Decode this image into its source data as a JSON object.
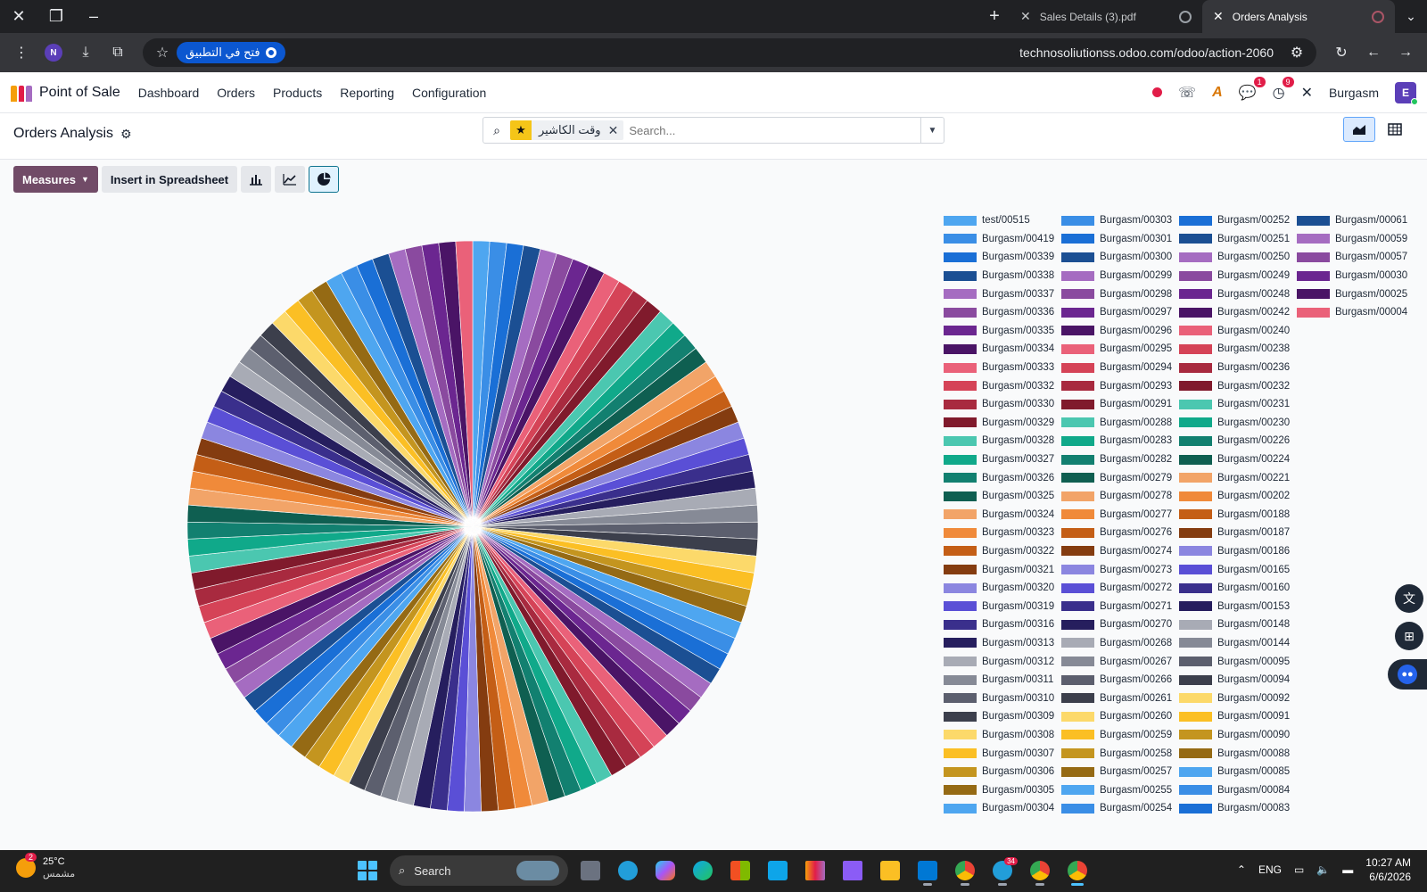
{
  "browser": {
    "tabs": [
      {
        "title": "Sales Details (3).pdf",
        "active": false
      },
      {
        "title": "Orders Analysis",
        "active": true
      }
    ],
    "profile_initial": "N",
    "open_in_app": "فتح في التطبيق",
    "url": "technosoliutionss.odoo.com/odoo/action-2060"
  },
  "navbar": {
    "app_name": "Point of Sale",
    "menu": [
      "Dashboard",
      "Orders",
      "Products",
      "Reporting",
      "Configuration"
    ],
    "messages_count": "1",
    "activities_count": "9",
    "company": "Burgasm",
    "user_initial": "E"
  },
  "control_panel": {
    "title": "Orders Analysis",
    "facet": "وقت الكاشير",
    "search_placeholder": "Search..."
  },
  "toolbar": {
    "measures": "Measures",
    "insert_spreadsheet": "Insert in Spreadsheet"
  },
  "chart_data": {
    "type": "pie",
    "legend_placement": "right",
    "series": [
      {
        "name": "test/00515",
        "value": 1,
        "color": "#4ea6f0"
      },
      {
        "name": "Burgasm/00419",
        "value": 1,
        "color": "#3a8ee6"
      },
      {
        "name": "Burgasm/00339",
        "value": 1,
        "color": "#1a6fd6"
      },
      {
        "name": "Burgasm/00338",
        "value": 1,
        "color": "#1b4f93"
      },
      {
        "name": "Burgasm/00337",
        "value": 1,
        "color": "#a56cc1"
      },
      {
        "name": "Burgasm/00336",
        "value": 1,
        "color": "#8a4a9f"
      },
      {
        "name": "Burgasm/00335",
        "value": 1,
        "color": "#6b2690"
      },
      {
        "name": "Burgasm/00334",
        "value": 1,
        "color": "#4a1466"
      },
      {
        "name": "Burgasm/00333",
        "value": 1,
        "color": "#ea6179"
      },
      {
        "name": "Burgasm/00332",
        "value": 1,
        "color": "#d54357"
      },
      {
        "name": "Burgasm/00330",
        "value": 1,
        "color": "#a82a3f"
      },
      {
        "name": "Burgasm/00329",
        "value": 1,
        "color": "#801a2c"
      },
      {
        "name": "Burgasm/00328",
        "value": 1,
        "color": "#4bc7b0"
      },
      {
        "name": "Burgasm/00327",
        "value": 1,
        "color": "#10a98a"
      },
      {
        "name": "Burgasm/00326",
        "value": 1,
        "color": "#128070"
      },
      {
        "name": "Burgasm/00325",
        "value": 1,
        "color": "#0f5f51"
      },
      {
        "name": "Burgasm/00324",
        "value": 1,
        "color": "#f2a468"
      },
      {
        "name": "Burgasm/00323",
        "value": 1,
        "color": "#f08a3a"
      },
      {
        "name": "Burgasm/00322",
        "value": 1,
        "color": "#c45e16"
      },
      {
        "name": "Burgasm/00321",
        "value": 1,
        "color": "#843c10"
      },
      {
        "name": "Burgasm/00320",
        "value": 1,
        "color": "#8b86e0"
      },
      {
        "name": "Burgasm/00319",
        "value": 1,
        "color": "#5a4fd6"
      },
      {
        "name": "Burgasm/00316",
        "value": 1,
        "color": "#3a2f8c"
      },
      {
        "name": "Burgasm/00313",
        "value": 1,
        "color": "#261e5e"
      },
      {
        "name": "Burgasm/00312",
        "value": 1,
        "color": "#a8abb5"
      },
      {
        "name": "Burgasm/00311",
        "value": 1,
        "color": "#868a96"
      },
      {
        "name": "Burgasm/00310",
        "value": 1,
        "color": "#5c5f6e"
      },
      {
        "name": "Burgasm/00309",
        "value": 1,
        "color": "#3c3f4c"
      },
      {
        "name": "Burgasm/00308",
        "value": 1,
        "color": "#fcd96a"
      },
      {
        "name": "Burgasm/00307",
        "value": 1,
        "color": "#fbbf24"
      },
      {
        "name": "Burgasm/00306",
        "value": 1,
        "color": "#c4951f"
      },
      {
        "name": "Burgasm/00305",
        "value": 1,
        "color": "#956a14"
      },
      {
        "name": "Burgasm/00304",
        "value": 1,
        "color": "#4ea6f0"
      },
      {
        "name": "Burgasm/00303",
        "value": 1,
        "color": "#3a8ee6"
      },
      {
        "name": "Burgasm/00301",
        "value": 1,
        "color": "#1a6fd6"
      },
      {
        "name": "Burgasm/00300",
        "value": 1,
        "color": "#1b4f93"
      },
      {
        "name": "Burgasm/00299",
        "value": 1,
        "color": "#a56cc1"
      },
      {
        "name": "Burgasm/00298",
        "value": 1,
        "color": "#8a4a9f"
      },
      {
        "name": "Burgasm/00297",
        "value": 1,
        "color": "#6b2690"
      },
      {
        "name": "Burgasm/00296",
        "value": 1,
        "color": "#4a1466"
      },
      {
        "name": "Burgasm/00295",
        "value": 1,
        "color": "#ea6179"
      },
      {
        "name": "Burgasm/00294",
        "value": 1,
        "color": "#d54357"
      },
      {
        "name": "Burgasm/00293",
        "value": 1,
        "color": "#a82a3f"
      },
      {
        "name": "Burgasm/00291",
        "value": 1,
        "color": "#801a2c"
      },
      {
        "name": "Burgasm/00288",
        "value": 1,
        "color": "#4bc7b0"
      },
      {
        "name": "Burgasm/00283",
        "value": 1,
        "color": "#10a98a"
      },
      {
        "name": "Burgasm/00282",
        "value": 1,
        "color": "#128070"
      },
      {
        "name": "Burgasm/00279",
        "value": 1,
        "color": "#0f5f51"
      },
      {
        "name": "Burgasm/00278",
        "value": 1,
        "color": "#f2a468"
      },
      {
        "name": "Burgasm/00277",
        "value": 1,
        "color": "#f08a3a"
      },
      {
        "name": "Burgasm/00276",
        "value": 1,
        "color": "#c45e16"
      },
      {
        "name": "Burgasm/00274",
        "value": 1,
        "color": "#843c10"
      },
      {
        "name": "Burgasm/00273",
        "value": 1,
        "color": "#8b86e0"
      },
      {
        "name": "Burgasm/00272",
        "value": 1,
        "color": "#5a4fd6"
      },
      {
        "name": "Burgasm/00271",
        "value": 1,
        "color": "#3a2f8c"
      },
      {
        "name": "Burgasm/00270",
        "value": 1,
        "color": "#261e5e"
      },
      {
        "name": "Burgasm/00268",
        "value": 1,
        "color": "#a8abb5"
      },
      {
        "name": "Burgasm/00267",
        "value": 1,
        "color": "#868a96"
      },
      {
        "name": "Burgasm/00266",
        "value": 1,
        "color": "#5c5f6e"
      },
      {
        "name": "Burgasm/00261",
        "value": 1,
        "color": "#3c3f4c"
      },
      {
        "name": "Burgasm/00260",
        "value": 1,
        "color": "#fcd96a"
      },
      {
        "name": "Burgasm/00259",
        "value": 1,
        "color": "#fbbf24"
      },
      {
        "name": "Burgasm/00258",
        "value": 1,
        "color": "#c4951f"
      },
      {
        "name": "Burgasm/00257",
        "value": 1,
        "color": "#956a14"
      },
      {
        "name": "Burgasm/00255",
        "value": 1,
        "color": "#4ea6f0"
      },
      {
        "name": "Burgasm/00254",
        "value": 1,
        "color": "#3a8ee6"
      },
      {
        "name": "Burgasm/00252",
        "value": 1,
        "color": "#1a6fd6"
      },
      {
        "name": "Burgasm/00251",
        "value": 1,
        "color": "#1b4f93"
      },
      {
        "name": "Burgasm/00250",
        "value": 1,
        "color": "#a56cc1"
      },
      {
        "name": "Burgasm/00249",
        "value": 1,
        "color": "#8a4a9f"
      },
      {
        "name": "Burgasm/00248",
        "value": 1,
        "color": "#6b2690"
      },
      {
        "name": "Burgasm/00242",
        "value": 1,
        "color": "#4a1466"
      },
      {
        "name": "Burgasm/00240",
        "value": 1,
        "color": "#ea6179"
      },
      {
        "name": "Burgasm/00238",
        "value": 1,
        "color": "#d54357"
      },
      {
        "name": "Burgasm/00236",
        "value": 1,
        "color": "#a82a3f"
      },
      {
        "name": "Burgasm/00232",
        "value": 1,
        "color": "#801a2c"
      },
      {
        "name": "Burgasm/00231",
        "value": 1,
        "color": "#4bc7b0"
      },
      {
        "name": "Burgasm/00230",
        "value": 1,
        "color": "#10a98a"
      },
      {
        "name": "Burgasm/00226",
        "value": 1,
        "color": "#128070"
      },
      {
        "name": "Burgasm/00224",
        "value": 1,
        "color": "#0f5f51"
      },
      {
        "name": "Burgasm/00221",
        "value": 1,
        "color": "#f2a468"
      },
      {
        "name": "Burgasm/00202",
        "value": 1,
        "color": "#f08a3a"
      },
      {
        "name": "Burgasm/00188",
        "value": 1,
        "color": "#c45e16"
      },
      {
        "name": "Burgasm/00187",
        "value": 1,
        "color": "#843c10"
      },
      {
        "name": "Burgasm/00186",
        "value": 1,
        "color": "#8b86e0"
      },
      {
        "name": "Burgasm/00165",
        "value": 1,
        "color": "#5a4fd6"
      },
      {
        "name": "Burgasm/00160",
        "value": 1,
        "color": "#3a2f8c"
      },
      {
        "name": "Burgasm/00153",
        "value": 1,
        "color": "#261e5e"
      },
      {
        "name": "Burgasm/00148",
        "value": 1,
        "color": "#a8abb5"
      },
      {
        "name": "Burgasm/00144",
        "value": 1,
        "color": "#868a96"
      },
      {
        "name": "Burgasm/00095",
        "value": 1,
        "color": "#5c5f6e"
      },
      {
        "name": "Burgasm/00094",
        "value": 1,
        "color": "#3c3f4c"
      },
      {
        "name": "Burgasm/00092",
        "value": 1,
        "color": "#fcd96a"
      },
      {
        "name": "Burgasm/00091",
        "value": 1,
        "color": "#fbbf24"
      },
      {
        "name": "Burgasm/00090",
        "value": 1,
        "color": "#c4951f"
      },
      {
        "name": "Burgasm/00088",
        "value": 1,
        "color": "#956a14"
      },
      {
        "name": "Burgasm/00085",
        "value": 1,
        "color": "#4ea6f0"
      },
      {
        "name": "Burgasm/00084",
        "value": 1,
        "color": "#3a8ee6"
      },
      {
        "name": "Burgasm/00083",
        "value": 1,
        "color": "#1a6fd6"
      },
      {
        "name": "Burgasm/00061",
        "value": 1,
        "color": "#1b4f93"
      },
      {
        "name": "Burgasm/00059",
        "value": 1,
        "color": "#a56cc1"
      },
      {
        "name": "Burgasm/00057",
        "value": 1,
        "color": "#8a4a9f"
      },
      {
        "name": "Burgasm/00030",
        "value": 1,
        "color": "#6b2690"
      },
      {
        "name": "Burgasm/00025",
        "value": 1,
        "color": "#4a1466"
      },
      {
        "name": "Burgasm/00004",
        "value": 1,
        "color": "#ea6179"
      }
    ]
  },
  "taskbar": {
    "weather_badge": "2",
    "temperature": "25°C",
    "weather_desc": "مشمس",
    "search_label": "Search",
    "telegram_badge": "34",
    "language": "ENG",
    "time": "10:27 AM",
    "date": "6/6/2026"
  },
  "icons": {
    "colors": {
      "odoo_primary": "#714b67",
      "accent_blue": "#0b57d0"
    }
  }
}
